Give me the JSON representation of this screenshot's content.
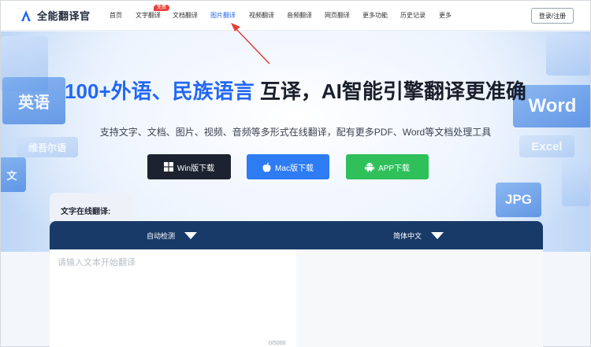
{
  "header": {
    "logo_text": "全能翻译官",
    "nav": [
      {
        "label": "首页"
      },
      {
        "label": "文字翻译",
        "badge": "免费"
      },
      {
        "label": "文档翻译"
      },
      {
        "label": "图片翻译",
        "active": true
      },
      {
        "label": "视频翻译"
      },
      {
        "label": "音频翻译"
      },
      {
        "label": "网页翻译"
      },
      {
        "label": "更多功能"
      },
      {
        "label": "历史记录"
      },
      {
        "label": "更多"
      }
    ],
    "login_label": "登录/注册"
  },
  "hero": {
    "title_highlight": "100+外语、民族语言",
    "title_rest": " 互译，AI智能引擎翻译更准确",
    "subtitle": "支持文字、文档、图片、视频、音频等多形式在线翻译，配有更多PDF、Word等文档处理工具",
    "deco_left": [
      "英语",
      "维吾尔语",
      "文"
    ],
    "deco_right": [
      "Word",
      "Excel",
      "JPG"
    ]
  },
  "downloads": {
    "win_label": "Win版下载",
    "mac_label": "Mac版下载",
    "app_label": "APP下载"
  },
  "translator": {
    "section_label": "文字在线翻译:",
    "source_lang": "自动检测",
    "target_lang": "简体中文",
    "input_placeholder": "请输入文本开始翻译",
    "char_count": "0/5000"
  },
  "colors": {
    "accent": "#2468f2",
    "bar": "#183a68",
    "win_btn": "#1c2230",
    "mac_btn": "#2d7cf3",
    "app_btn": "#2fc05a",
    "badge": "#e8413a",
    "annotation_arrow": "#e0443a"
  }
}
